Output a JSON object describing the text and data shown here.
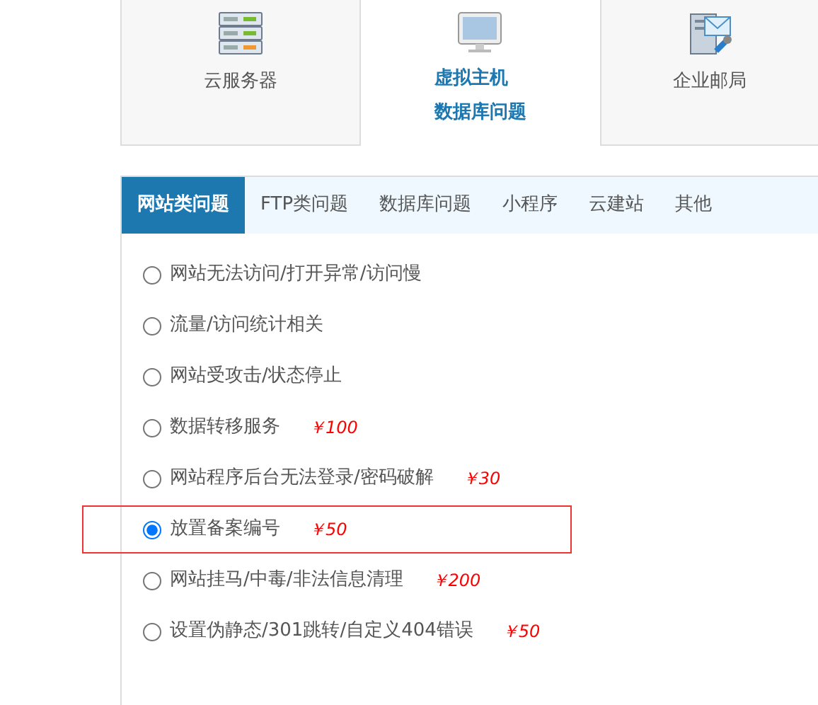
{
  "products": [
    {
      "kind": "server",
      "lines": [
        "云服务器"
      ],
      "selected": false
    },
    {
      "kind": "monitor",
      "lines": [
        "虚拟主机",
        "数据库问题"
      ],
      "selected": true
    },
    {
      "kind": "mail",
      "lines": [
        "企业邮局"
      ],
      "selected": false
    }
  ],
  "tabs": [
    {
      "label": "网站类问题",
      "selected": true
    },
    {
      "label": "FTP类问题",
      "selected": false
    },
    {
      "label": "数据库问题",
      "selected": false
    },
    {
      "label": "小程序",
      "selected": false
    },
    {
      "label": "云建站",
      "selected": false
    },
    {
      "label": "其他",
      "selected": false
    }
  ],
  "options": [
    {
      "label": "网站无法访问/打开异常/访问慢",
      "selected": false
    },
    {
      "label": "流量/访问统计相关",
      "selected": false
    },
    {
      "label": "网站受攻击/状态停止",
      "selected": false
    },
    {
      "label": "数据转移服务",
      "price": "￥100",
      "selected": false
    },
    {
      "label": "网站程序后台无法登录/密码破解",
      "price": "￥30",
      "selected": false
    },
    {
      "label": "放置备案编号",
      "price": "￥50",
      "selected": true
    },
    {
      "label": "网站挂马/中毒/非法信息清理",
      "price": "￥200",
      "selected": false
    },
    {
      "label": "设置伪静态/301跳转/自定义404错误",
      "price": "￥50",
      "selected": false
    }
  ]
}
